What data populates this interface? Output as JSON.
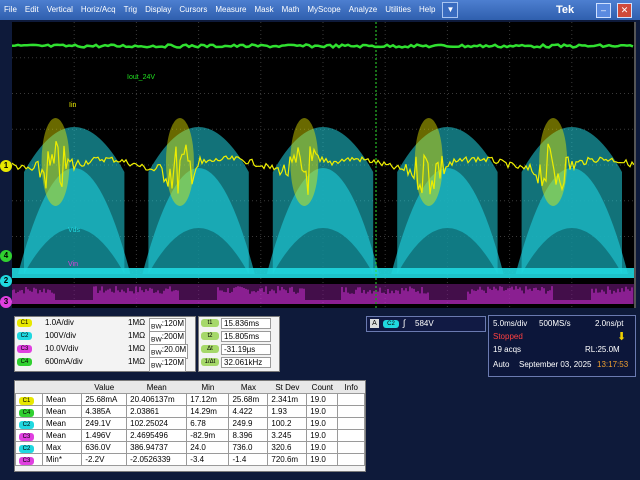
{
  "menu": {
    "items": [
      "File",
      "Edit",
      "Vertical",
      "Horiz/Acq",
      "Trig",
      "Display",
      "Cursors",
      "Measure",
      "Mask",
      "Math",
      "MyScope",
      "Analyze",
      "Utilities",
      "Help"
    ],
    "dropdown_icon": "chevron-down-icon",
    "brand": "Tek"
  },
  "window": {
    "minimize_icon": "minimize-icon",
    "close_icon": "close-icon"
  },
  "waveform_labels": {
    "iout": "Iout_24V",
    "iin": "Iin",
    "vds": "Vds",
    "vin": "Vin"
  },
  "channel_markers": [
    "1",
    "4",
    "2",
    "3"
  ],
  "channels": [
    {
      "badge": "C1",
      "scale": "1.0A/div",
      "impedance": "1MΩ",
      "bw": "120M",
      "color": "#e8e800"
    },
    {
      "badge": "C2",
      "scale": "100V/div",
      "impedance": "1MΩ",
      "bw": "200M",
      "color": "#20d8e0"
    },
    {
      "badge": "C3",
      "scale": "10.0V/div",
      "impedance": "1MΩ",
      "bw": "20.0M",
      "color": "#e040e0"
    },
    {
      "badge": "C4",
      "scale": "600mA/div",
      "impedance": "1MΩ",
      "bw": "120M",
      "color": "#30d030"
    }
  ],
  "cursors": [
    {
      "badge": "t1",
      "value": "15.836ms"
    },
    {
      "badge": "t2",
      "value": "15.805ms"
    },
    {
      "badge": "Δt",
      "value": "-31.19μs"
    },
    {
      "badge": "1/Δt",
      "value": "32.061kHz"
    }
  ],
  "trigger": {
    "source_badge": "C2",
    "slope_icon": "rising-edge-icon",
    "level": "584V"
  },
  "acquisition": {
    "timebase": "5.0ms/div",
    "sample_rate": "500MS/s",
    "resolution": "2.0ns/pt",
    "state": "Stopped",
    "acqs": "19 acqs",
    "record_length": "RL:25.0M",
    "mode": "Auto",
    "date": "September 03, 2025",
    "time": "13:17:53"
  },
  "measurements": {
    "headers": [
      "",
      "",
      "Value",
      "Mean",
      "Min",
      "Max",
      "St Dev",
      "Count",
      "Info"
    ],
    "rows": [
      {
        "badge": "C1",
        "color": "#e8e800",
        "name": "Mean",
        "value": "25.68mA",
        "mean": "20.406137m",
        "min": "17.12m",
        "max": "25.68m",
        "stdev": "2.341m",
        "count": "19.0",
        "info": ""
      },
      {
        "badge": "C4",
        "color": "#30d030",
        "name": "Mean",
        "value": "4.385A",
        "mean": "2.03861",
        "min": "14.29m",
        "max": "4.422",
        "stdev": "1.93",
        "count": "19.0",
        "info": ""
      },
      {
        "badge": "C2",
        "color": "#20d8e0",
        "name": "Mean",
        "value": "249.1V",
        "mean": "102.25024",
        "min": "6.78",
        "max": "249.9",
        "stdev": "100.2",
        "count": "19.0",
        "info": ""
      },
      {
        "badge": "C3",
        "color": "#e040e0",
        "name": "Mean",
        "value": "1.496V",
        "mean": "2.4695496",
        "min": "-82.9m",
        "max": "8.396",
        "stdev": "3.245",
        "count": "19.0",
        "info": ""
      },
      {
        "badge": "C2",
        "color": "#20d8e0",
        "name": "Max",
        "value": "636.0V",
        "mean": "386.94737",
        "min": "24.0",
        "max": "736.0",
        "stdev": "320.6",
        "count": "19.0",
        "info": ""
      },
      {
        "badge": "C3",
        "color": "#e040e0",
        "name": "Min*",
        "value": "-2.2V",
        "mean": "-2.0526339",
        "min": "-3.4",
        "max": "-1.4",
        "stdev": "720.6m",
        "count": "19.0",
        "info": ""
      }
    ]
  }
}
